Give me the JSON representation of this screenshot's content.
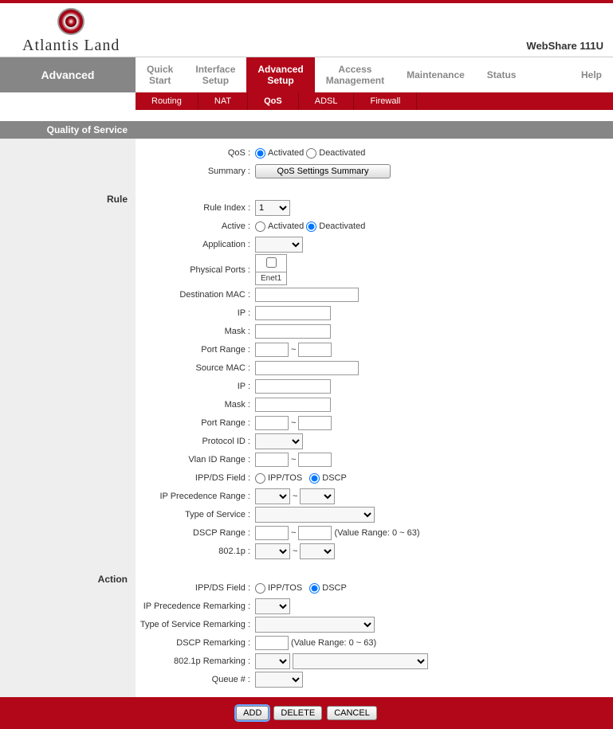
{
  "brand": "Atlantis Land",
  "product": "WebShare 111U",
  "mainnav": {
    "activeLabel": "Advanced",
    "items": [
      {
        "label1": "Quick",
        "label2": "Start"
      },
      {
        "label1": "Interface",
        "label2": "Setup"
      },
      {
        "label1": "Advanced",
        "label2": "Setup",
        "active": true
      },
      {
        "label1": "Access",
        "label2": "Management"
      },
      {
        "label1": "Maintenance",
        "label2": ""
      },
      {
        "label1": "Status",
        "label2": ""
      },
      {
        "label1": "Help",
        "label2": ""
      }
    ]
  },
  "subnav": {
    "items": [
      "Routing",
      "NAT",
      "QoS",
      "ADSL",
      "Firewall"
    ],
    "active": "QoS"
  },
  "sectionTitle": "Quality of Service",
  "labels": {
    "qos": "QoS :",
    "summary": "Summary :",
    "ruleHeader": "Rule",
    "ruleIndex": "Rule Index :",
    "active": "Active :",
    "application": "Application :",
    "physicalPorts": "Physical Ports :",
    "destMac": "Destination MAC :",
    "ip": "IP :",
    "mask": "Mask :",
    "portRange": "Port Range :",
    "srcMac": "Source MAC :",
    "protocolId": "Protocol ID :",
    "vlanIdRange": "Vlan ID Range :",
    "ippDs": "IPP/DS Field :",
    "ipPrecRange": "IP Precedence Range :",
    "tos": "Type of Service :",
    "dscpRange": "DSCP Range :",
    "dot1p": "802.1p :",
    "actionHeader": "Action",
    "ippDs2": "IPP/DS Field :",
    "ipPrecRemark": "IP Precedence Remarking :",
    "tosRemark": "Type of Service Remarking :",
    "dscpRemark": "DSCP Remarking :",
    "dot1pRemark": "802.1p Remarking :",
    "queueNum": "Queue # :"
  },
  "values": {
    "summaryBtn": "QoS Settings Summary",
    "ruleIndex": "1",
    "portLabel": "Enet1",
    "dscpNote": "(Value Range: 0 ~ 63)",
    "dscpNote2": "(Value Range: 0 ~ 63)",
    "tilde": "~"
  },
  "radios": {
    "activated": "Activated",
    "deactivated": "Deactivated",
    "ipptos": "IPP/TOS",
    "dscp": "DSCP"
  },
  "footer": {
    "add": "ADD",
    "delete": "DELETE",
    "cancel": "CANCEL"
  }
}
